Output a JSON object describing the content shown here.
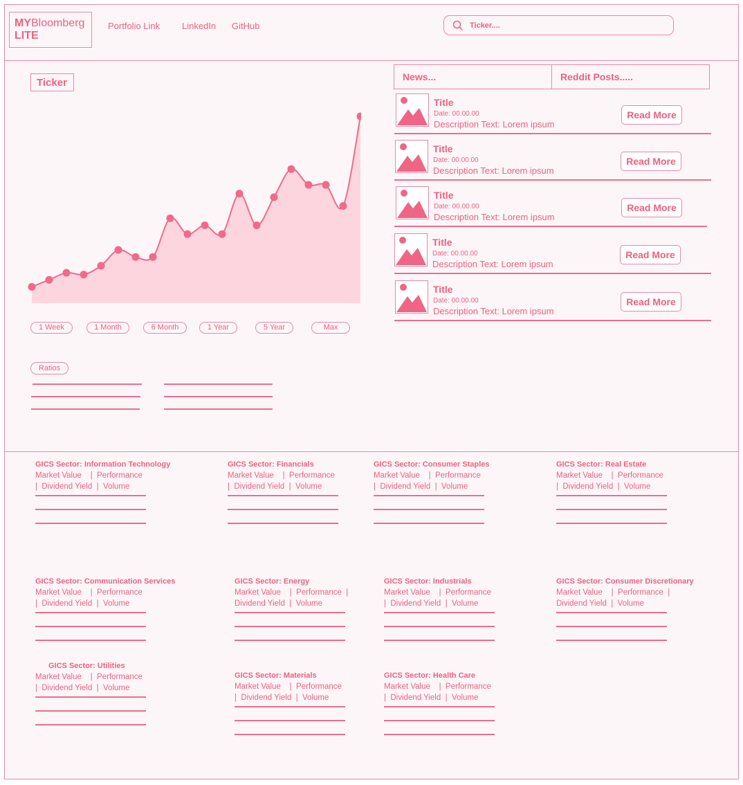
{
  "header": {
    "logo_bold": "MY",
    "logo_rest": "Bloomberg",
    "logo_line2": "LITE",
    "nav": [
      "Portfolio Link",
      "LinkedIn",
      "GitHub"
    ],
    "search_placeholder": "Ticker...."
  },
  "ticker": {
    "label": "Ticker",
    "ranges": [
      "1 Week",
      "1 Month",
      "6 Month",
      "1 Year",
      "5 Year",
      "Max"
    ],
    "ratios_label": "Ratios"
  },
  "chart_data": {
    "type": "area",
    "title": "",
    "xlabel": "",
    "ylabel": "",
    "values": [
      3,
      7,
      11,
      10,
      15,
      24,
      20,
      20,
      42,
      33,
      38,
      33,
      56,
      38,
      54,
      70,
      61,
      61,
      49,
      100
    ],
    "ylim": [
      0,
      100
    ],
    "grid": false,
    "legend": "none",
    "colors": {
      "line": "#f06a8a",
      "fill": "#fdd5de",
      "marker": "#f06a8a"
    }
  },
  "news": {
    "tabs": [
      "News...",
      "Reddit Posts....."
    ],
    "items": [
      {
        "title": "Title",
        "date": "Date: 00.00.00",
        "description": "Description Text: Lorem ipsum",
        "button": "Read More"
      },
      {
        "title": "Title",
        "date": "Date: 00.00.00",
        "description": "Description Text: Lorem ipsum",
        "button": "Read More"
      },
      {
        "title": "Title",
        "date": "Date: 00.00.00",
        "description": "Description Text: Lorem ipsum",
        "button": "Read More"
      },
      {
        "title": "Title",
        "date": "Date: 00.00.00",
        "description": "Description Text: Lorem ipsum",
        "button": "Read More"
      },
      {
        "title": "Title",
        "date": "Date: 00.00.00",
        "description": "Description Text: Lorem ipsum",
        "button": "Read More"
      }
    ]
  },
  "sectors": [
    {
      "title": "GICS Sector: Information Technology",
      "metrics": "Market Value    |  Performance\n|  Dividend Yield  |  Volume"
    },
    {
      "title": "GICS Sector: Financials",
      "metrics": "Market Value    |  Performance\n|  Dividend Yield  |  Volume"
    },
    {
      "title": "GICS Sector: Consumer Staples",
      "metrics": "Market Value    |  Performance\n|  Dividend Yield  |  Volume"
    },
    {
      "title": "GICS Sector: Real Estate",
      "metrics": "Market Value    |  Performance\n|  Dividend Yield  |  Volume"
    },
    {
      "title": "GICS Sector: Communication Services",
      "metrics": "Market Value    |  Performance\n|  Dividend Yield  |  Volume"
    },
    {
      "title": "GICS Sector: Energy",
      "metrics": "Market Value    |  Performance  |\nDividend Yield  |  Volume"
    },
    {
      "title": "GICS Sector: Industrials",
      "metrics": "Market Value    |  Performance\n|  Dividend Yield  |  Volume"
    },
    {
      "title": "GICS Sector: Consumer Discretionary",
      "metrics": "Market Value    |  Performance  |\nDividend Yield  |  Volume"
    },
    {
      "title": "GICS Sector: Utilities",
      "metrics": "Market Value    |  Performance\n|  Dividend Yield  |  Volume"
    },
    {
      "title": "GICS Sector: Materials",
      "metrics": "Market Value    |  Performance\n|  Dividend Yield  |  Volume"
    },
    {
      "title": "GICS Sector: Health Care",
      "metrics": "Market Value    |  Performance\n|  Dividend Yield  |  Volume"
    }
  ]
}
